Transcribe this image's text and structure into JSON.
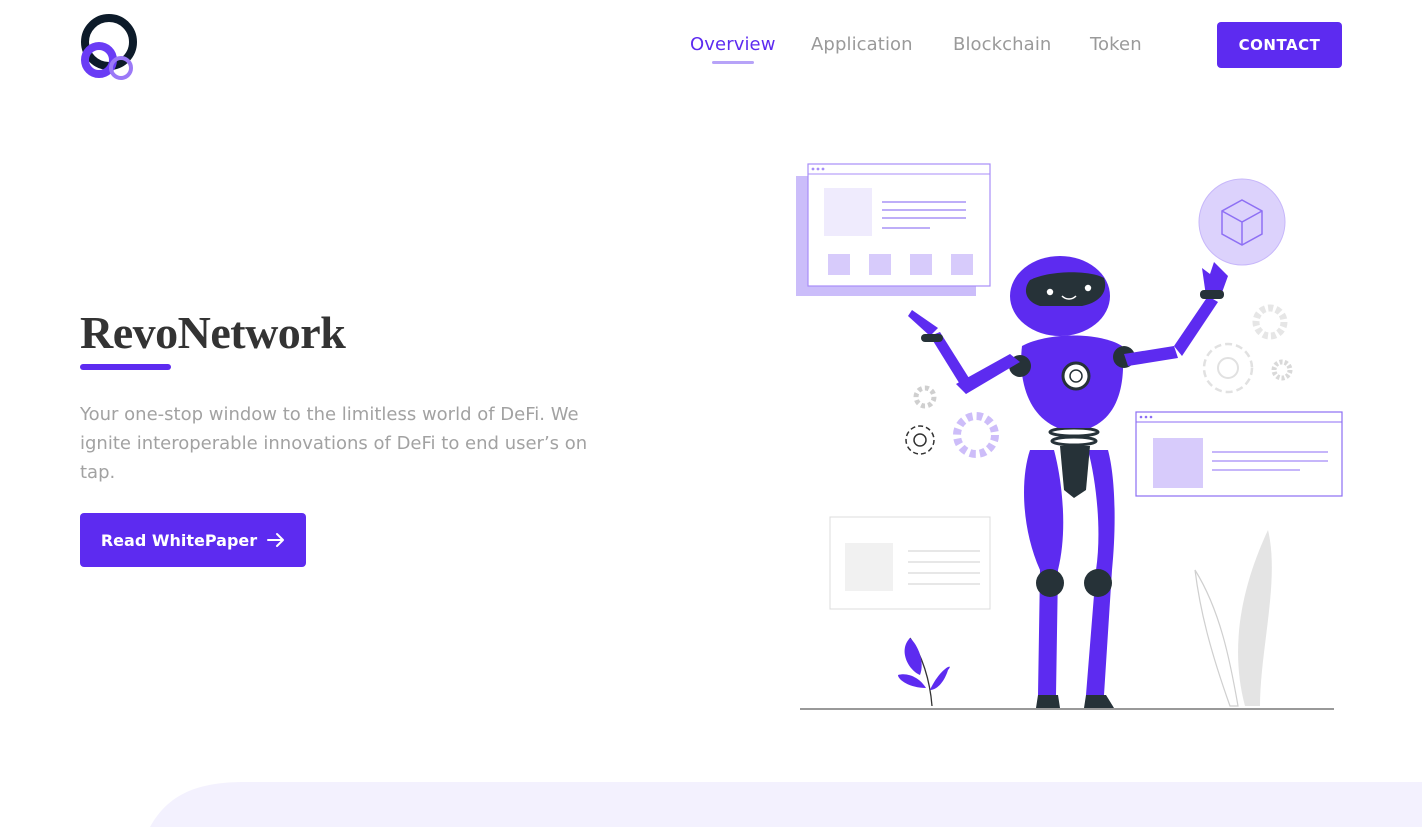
{
  "brand": {
    "logo_icon": "revo-rings-logo"
  },
  "nav": {
    "items": [
      {
        "label": "Overview",
        "active": true
      },
      {
        "label": "Application",
        "active": false
      },
      {
        "label": "Blockchain",
        "active": false
      },
      {
        "label": "Token",
        "active": false
      }
    ],
    "contact_label": "CONTACT"
  },
  "hero": {
    "title": "RevoNetwork",
    "description": "Your one-stop window to the limitless world of DeFi. We ignite interoperable innovations of DeFi to end user’s on tap.",
    "cta_label": "Read WhitePaper",
    "cta_icon": "arrow-right-icon"
  },
  "colors": {
    "accent": "#5d2bf0",
    "accent_light": "#b7a3f8",
    "text_dark": "#333333",
    "text_muted": "#a2a2a2",
    "panel_bg": "#f3f1fe"
  }
}
